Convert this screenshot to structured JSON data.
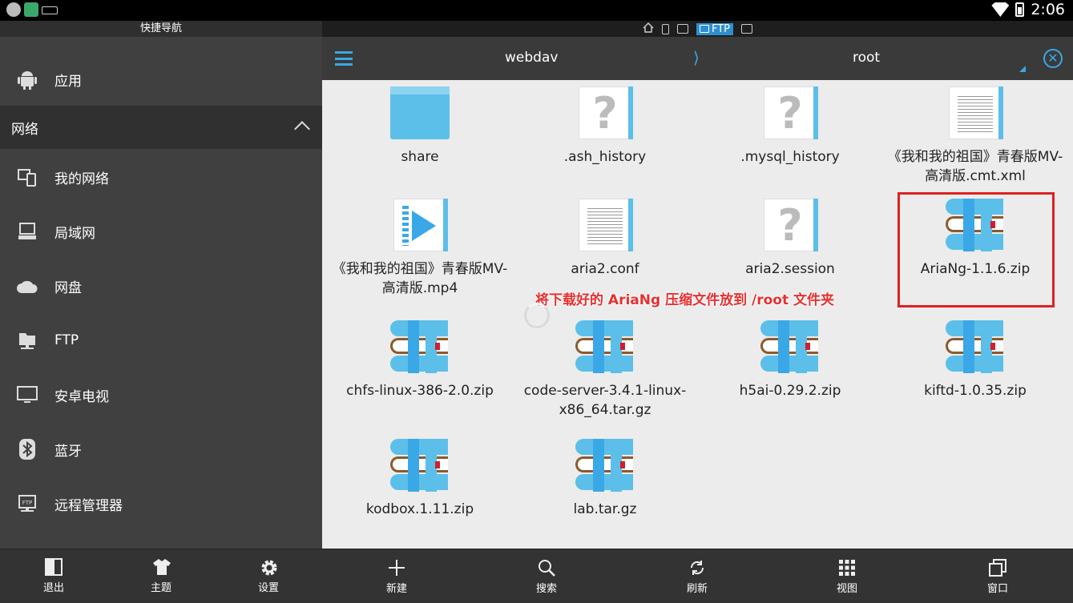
{
  "status_bar": {
    "time": "2:06"
  },
  "drawer": {
    "title": "快捷导航",
    "items_top": [
      {
        "label": "应用",
        "icon": "android-icon"
      }
    ],
    "section": {
      "label": "网络"
    },
    "items": [
      {
        "label": "我的网络",
        "icon": "devices-icon"
      },
      {
        "label": "局域网",
        "icon": "computer-icon"
      },
      {
        "label": "网盘",
        "icon": "cloud-icon"
      },
      {
        "label": "FTP",
        "icon": "ftp-server-icon"
      },
      {
        "label": "安卓电视",
        "icon": "tv-icon"
      },
      {
        "label": "蓝牙",
        "icon": "bluetooth-icon"
      },
      {
        "label": "远程管理器",
        "icon": "remote-ftp-icon"
      }
    ],
    "bottom": [
      {
        "label": "退出",
        "icon": "exit-icon"
      },
      {
        "label": "主题",
        "icon": "shirt-icon"
      },
      {
        "label": "设置",
        "icon": "gear-icon"
      }
    ]
  },
  "topbar": {
    "ftp_label": "FTP"
  },
  "toolbar": {
    "crumb1": "webdav",
    "sep": "⟩",
    "crumb2": "root"
  },
  "files": [
    {
      "name": "share",
      "type": "folder"
    },
    {
      "name": ".ash_history",
      "type": "unknown"
    },
    {
      "name": ".mysql_history",
      "type": "unknown"
    },
    {
      "name": "《我和我的祖国》青春版MV-高清版.cmt.xml",
      "type": "text"
    },
    {
      "name": "《我和我的祖国》青春版MV-高清版.mp4",
      "type": "video"
    },
    {
      "name": "aria2.conf",
      "type": "text"
    },
    {
      "name": "aria2.session",
      "type": "unknown"
    },
    {
      "name": "AriaNg-1.1.6.zip",
      "type": "zip"
    },
    {
      "name": "chfs-linux-386-2.0.zip",
      "type": "zip"
    },
    {
      "name": "code-server-3.4.1-linux-x86_64.tar.gz",
      "type": "zip"
    },
    {
      "name": "h5ai-0.29.2.zip",
      "type": "zip"
    },
    {
      "name": "kiftd-1.0.35.zip",
      "type": "zip"
    },
    {
      "name": "kodbox.1.11.zip",
      "type": "zip"
    },
    {
      "name": "lab.tar.gz",
      "type": "zip"
    }
  ],
  "annotation": "将下载好的 AriaNg 压缩文件放到 /root 文件夹",
  "bottom_bar": [
    {
      "label": "新建",
      "icon": "plus-icon"
    },
    {
      "label": "搜索",
      "icon": "search-icon"
    },
    {
      "label": "刷新",
      "icon": "refresh-icon"
    },
    {
      "label": "视图",
      "icon": "grid-view-icon"
    },
    {
      "label": "窗口",
      "icon": "windows-icon"
    }
  ]
}
